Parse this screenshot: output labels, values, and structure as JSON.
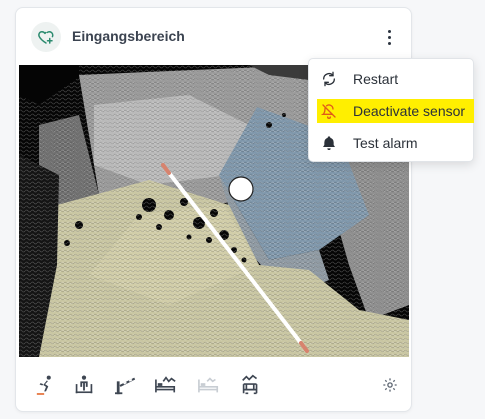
{
  "card": {
    "title": "Eingangsbereich",
    "device_icon": "heart-plus-icon",
    "menu_button_icon": "kebab-vertical-icon"
  },
  "menu": {
    "items": [
      {
        "label": "Restart",
        "icon": "refresh-icon"
      },
      {
        "label": "Deactivate sensor",
        "icon": "bell-off-icon",
        "highlighted": true
      },
      {
        "label": "Test alarm",
        "icon": "bell-icon"
      }
    ]
  },
  "toolbar": {
    "tools": [
      {
        "icon": "person-fall-icon"
      },
      {
        "icon": "person-seated-icon"
      },
      {
        "icon": "barrier-icon"
      },
      {
        "icon": "bed-activity-icon"
      },
      {
        "icon": "bed-empty-icon"
      },
      {
        "icon": "chair-activity-icon"
      }
    ],
    "settings_icon": "gear-icon"
  },
  "colors": {
    "accent": "#2b8a6e",
    "highlight": "#ffef00",
    "alert_icon": "#e05a1a"
  }
}
